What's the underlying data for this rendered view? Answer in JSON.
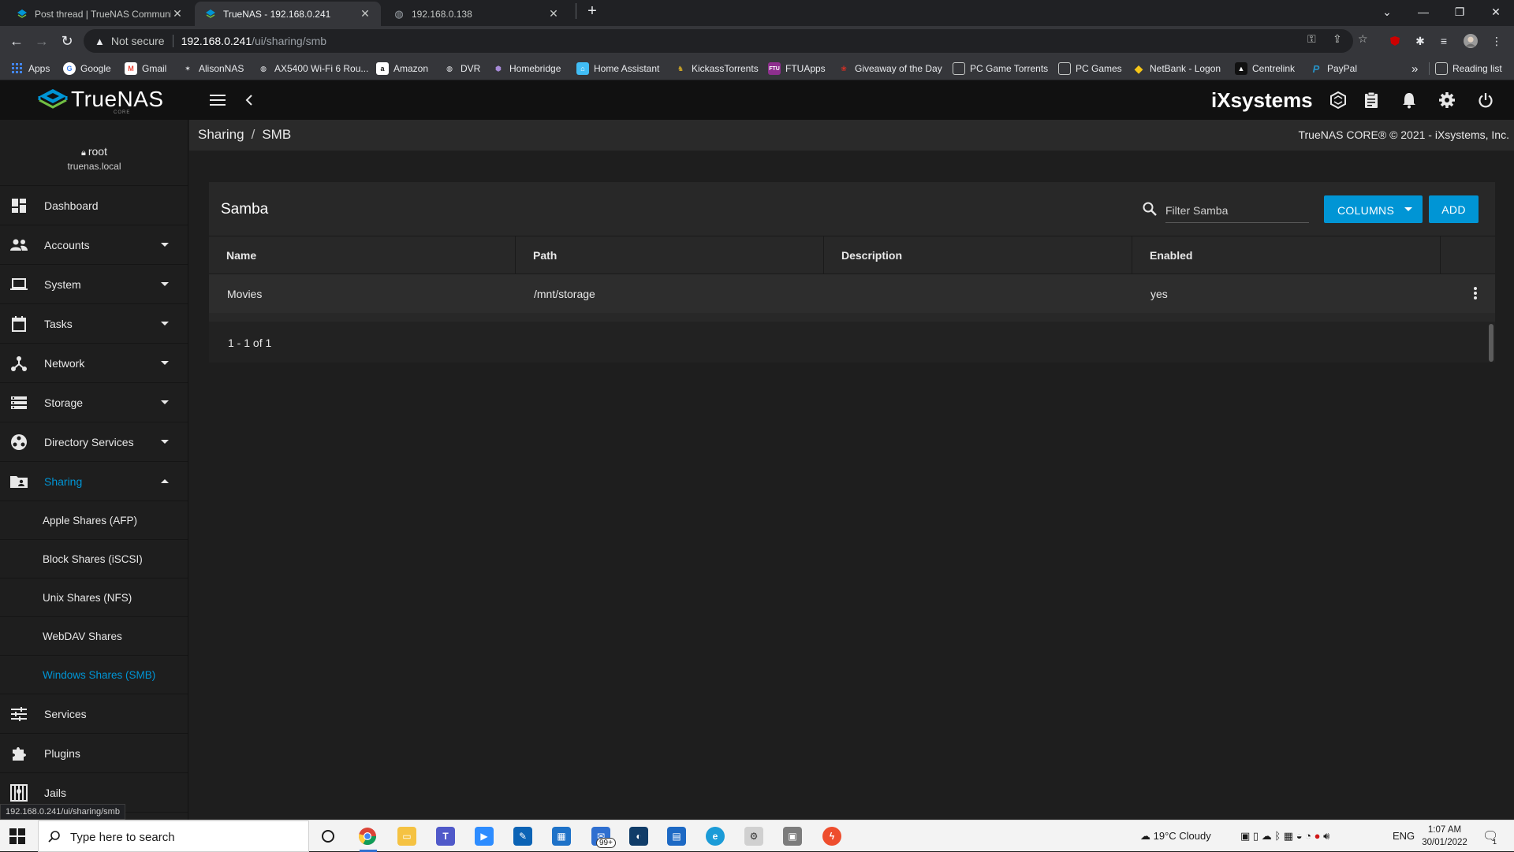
{
  "browser": {
    "tabs": [
      {
        "title": "Post thread | TrueNAS Communit"
      },
      {
        "title": "TrueNAS - 192.168.0.241"
      },
      {
        "title": "192.168.0.138"
      }
    ],
    "address": {
      "security_label": "Not secure",
      "host": "192.168.0.241",
      "path": "/ui/sharing/smb"
    },
    "bookmarks": [
      {
        "label": "Apps",
        "color": "#e8eaed"
      },
      {
        "label": "Google",
        "color": "#4285f4"
      },
      {
        "label": "Gmail",
        "color": "#ea4335"
      },
      {
        "label": "AlisonNAS",
        "color": "#5f6368"
      },
      {
        "label": "AX5400 Wi-Fi 6 Rou...",
        "color": "#5f6368"
      },
      {
        "label": "Amazon",
        "color": "#3c3c3c"
      },
      {
        "label": "DVR",
        "color": "#5f6368"
      },
      {
        "label": "Homebridge",
        "color": "#7b4fb5"
      },
      {
        "label": "Home Assistant",
        "color": "#41bdf5"
      },
      {
        "label": "KickassTorrents",
        "color": "#c9a227"
      },
      {
        "label": "FTUApps",
        "color": "#8e2f8e"
      },
      {
        "label": "Giveaway of the Day",
        "color": "#d93025"
      },
      {
        "label": "PC Game Torrents",
        "color": "#5f6368"
      },
      {
        "label": "PC Games",
        "color": "#5f6368"
      },
      {
        "label": "NetBank - Logon",
        "color": "#f5c518"
      },
      {
        "label": "Centrelink",
        "color": "#111111"
      },
      {
        "label": "PayPal",
        "color": "#003087"
      }
    ],
    "more_label": "»",
    "reading_list_label": "Reading list",
    "status_url": "192.168.0.241/ui/sharing/smb"
  },
  "app": {
    "logo_text": "TrueNAS",
    "logo_sub": "CORE",
    "vendor_logo": "iXsystems",
    "breadcrumb": {
      "parent": "Sharing",
      "current": "SMB"
    },
    "copyright": "TrueNAS CORE® © 2021 - iXsystems, Inc.",
    "user": {
      "name": "root",
      "host": "truenas.local"
    },
    "nav": [
      {
        "label": "Dashboard",
        "icon": "dashboard-icon"
      },
      {
        "label": "Accounts",
        "icon": "accounts-icon"
      },
      {
        "label": "System",
        "icon": "laptop-icon"
      },
      {
        "label": "Tasks",
        "icon": "calendar-icon"
      },
      {
        "label": "Network",
        "icon": "network-icon"
      },
      {
        "label": "Storage",
        "icon": "storage-icon"
      },
      {
        "label": "Directory Services",
        "icon": "directory-icon"
      },
      {
        "label": "Sharing",
        "icon": "folder-shared-icon"
      }
    ],
    "sharing_sub": [
      {
        "label": "Apple Shares (AFP)"
      },
      {
        "label": "Block Shares (iSCSI)"
      },
      {
        "label": "Unix Shares (NFS)"
      },
      {
        "label": "WebDAV Shares"
      },
      {
        "label": "Windows Shares (SMB)"
      }
    ],
    "nav_after": [
      {
        "label": "Services",
        "icon": "tune-icon"
      },
      {
        "label": "Plugins",
        "icon": "puzzle-icon"
      },
      {
        "label": "Jails",
        "icon": "jail-icon"
      }
    ],
    "accent_color": "#0095d5"
  },
  "samba": {
    "title": "Samba",
    "filter_placeholder": "Filter Samba",
    "columns_label": "COLUMNS",
    "add_label": "ADD",
    "columns": [
      "Name",
      "Path",
      "Description",
      "Enabled"
    ],
    "rows": [
      {
        "name": "Movies",
        "path": "/mnt/storage",
        "description": "",
        "enabled": "yes"
      }
    ],
    "pager": "1 - 1 of 1"
  },
  "taskbar": {
    "search_placeholder": "Type here to search",
    "weather": "19°C  Cloudy",
    "lang": "ENG",
    "time": "1:07 AM",
    "date": "30/01/2022",
    "mail_badge": "99+",
    "notification_badge": "1"
  }
}
